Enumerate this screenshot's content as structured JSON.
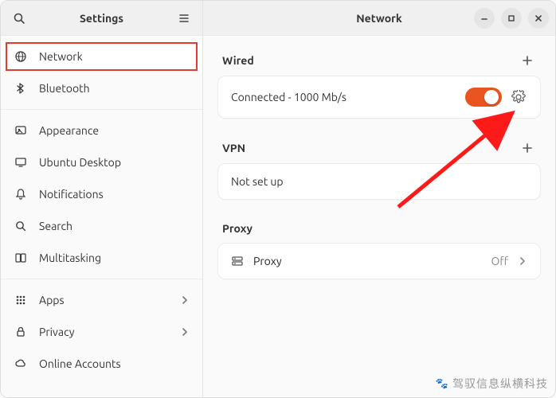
{
  "sidebar": {
    "title": "Settings",
    "items": [
      {
        "label": "Network",
        "icon": "globe-icon",
        "selected": true
      },
      {
        "label": "Bluetooth",
        "icon": "bluetooth-icon"
      },
      {
        "label": "Appearance",
        "icon": "appearance-icon"
      },
      {
        "label": "Ubuntu Desktop",
        "icon": "desktop-icon"
      },
      {
        "label": "Notifications",
        "icon": "bell-icon"
      },
      {
        "label": "Search",
        "icon": "search-icon"
      },
      {
        "label": "Multitasking",
        "icon": "multitasking-icon"
      },
      {
        "label": "Apps",
        "icon": "apps-icon",
        "chevron": true
      },
      {
        "label": "Privacy",
        "icon": "privacy-icon",
        "chevron": true
      },
      {
        "label": "Online Accounts",
        "icon": "cloud-icon"
      }
    ]
  },
  "main": {
    "title": "Network",
    "wired": {
      "heading": "Wired",
      "status": "Connected - 1000 Mb/s",
      "switch_on": true
    },
    "vpn": {
      "heading": "VPN",
      "status": "Not set up"
    },
    "proxy": {
      "heading": "Proxy",
      "row_label": "Proxy",
      "value": "Off"
    }
  },
  "watermark": "驾驭信息纵横科技",
  "colors": {
    "accent": "#e95420",
    "highlight_border": "#e23c2b"
  }
}
